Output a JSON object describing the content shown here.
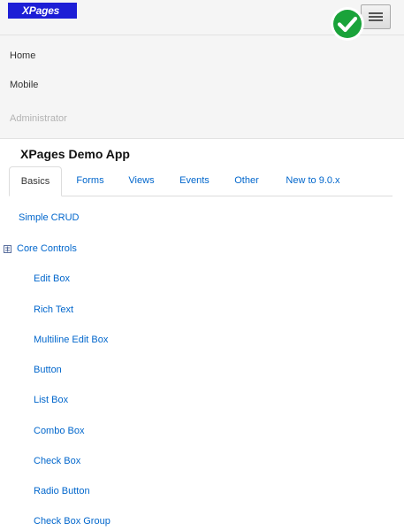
{
  "header": {
    "logo_text": "XPages",
    "menu_icon": "hamburger-menu-icon",
    "badge_icon": "check-circle-icon",
    "badge_color": "#1aa33a"
  },
  "nav": {
    "items": [
      {
        "label": "Home"
      },
      {
        "label": "Mobile"
      },
      {
        "label": "Administrator"
      }
    ]
  },
  "main": {
    "title": "XPages Demo App",
    "tabs": [
      {
        "label": "Basics"
      },
      {
        "label": "Forms"
      },
      {
        "label": "Views"
      },
      {
        "label": "Events"
      },
      {
        "label": "Other"
      },
      {
        "label": "New to 9.0.x"
      }
    ],
    "tree": {
      "top": {
        "label": "Simple CRUD"
      },
      "group": {
        "label": "Core Controls"
      },
      "children": [
        {
          "label": "Edit Box"
        },
        {
          "label": "Rich Text"
        },
        {
          "label": "Multiline Edit Box"
        },
        {
          "label": "Button"
        },
        {
          "label": "List Box"
        },
        {
          "label": "Combo Box"
        },
        {
          "label": "Check Box"
        },
        {
          "label": "Radio Button"
        },
        {
          "label": "Check Box Group"
        }
      ]
    }
  },
  "colors": {
    "logo_bg": "#1d1ed6",
    "link": "#0066cc",
    "nav_bg": "#f5f5f5"
  }
}
